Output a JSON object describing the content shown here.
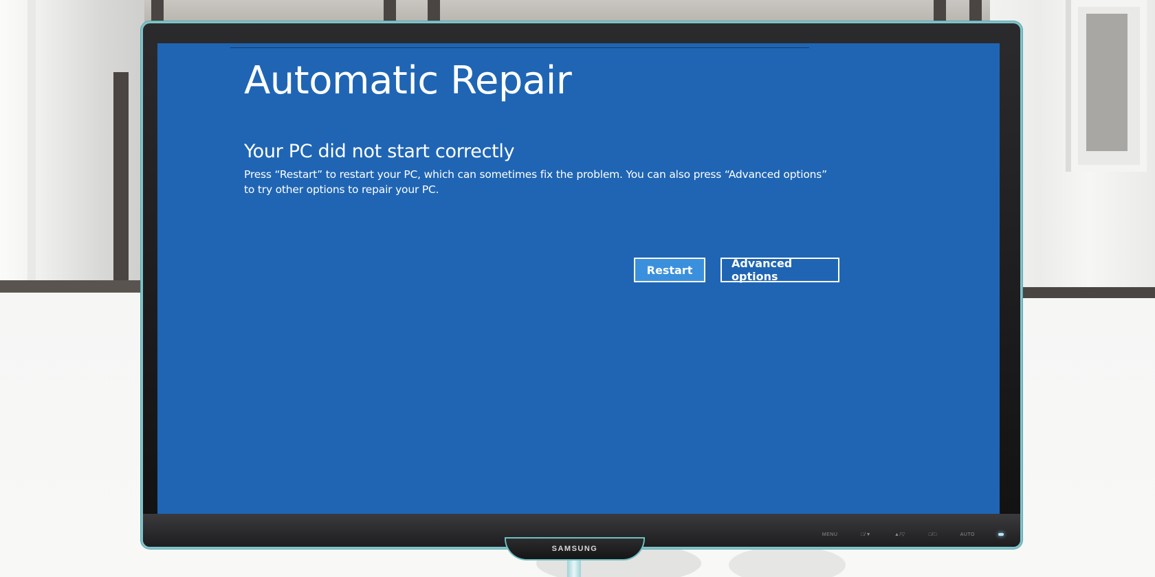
{
  "screen": {
    "title": "Automatic Repair",
    "subtitle": "Your PC did not start correctly",
    "message": "Press “Restart” to restart your PC, which can sometimes fix the problem. You can also press “Advanced options” to try other options to repair your PC.",
    "background_color": "#1f65b4",
    "buttons": {
      "restart_label": "Restart",
      "advanced_label": "Advanced options",
      "restart_color": "#3a90dc"
    }
  },
  "monitor": {
    "brand": "SAMSUNG",
    "controls": [
      "MENU",
      "□/▼",
      "▲/▽",
      "□/□",
      "AUTO"
    ]
  }
}
